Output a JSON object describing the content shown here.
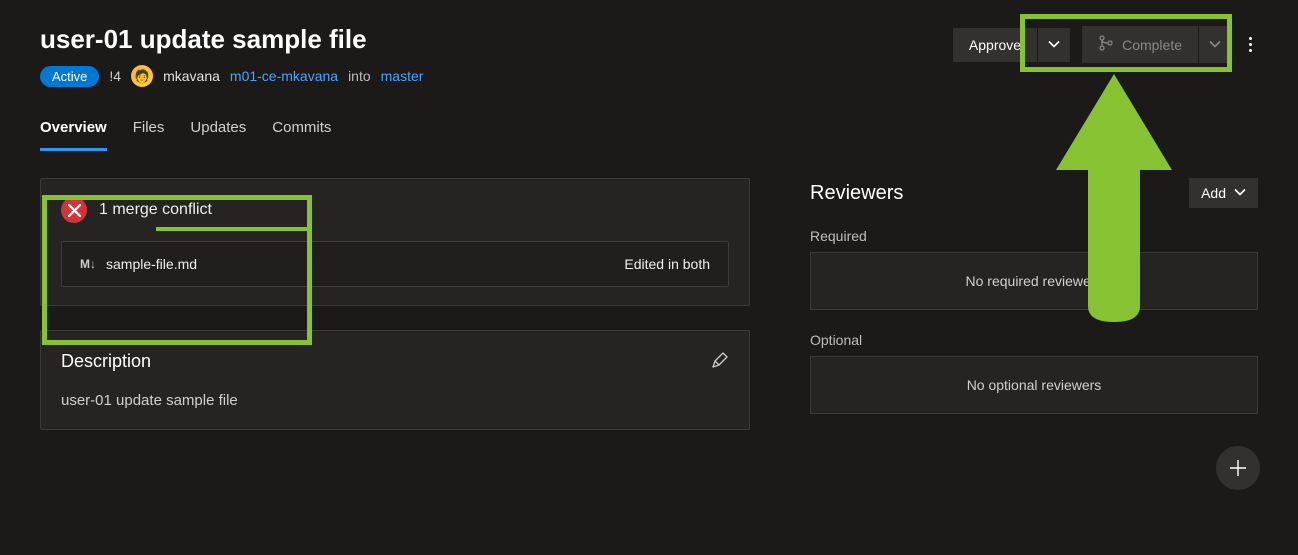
{
  "header": {
    "title": "user-01 update sample file",
    "status_badge": "Active",
    "conflict_indicator": "!4",
    "author": "mkavana",
    "source_branch": "m01-ce-mkavana",
    "into_word": "into",
    "target_branch": "master"
  },
  "actions": {
    "approve_label": "Approve",
    "complete_label": "Complete"
  },
  "tabs": [
    "Overview",
    "Files",
    "Updates",
    "Commits"
  ],
  "active_tab": "Overview",
  "conflict": {
    "title": "1 merge conflict",
    "file_name": "sample-file.md",
    "file_status": "Edited in both"
  },
  "description": {
    "heading": "Description",
    "body": "user-01 update sample file"
  },
  "reviewers": {
    "heading": "Reviewers",
    "add_label": "Add",
    "required_label": "Required",
    "required_empty": "No required reviewers",
    "optional_label": "Optional",
    "optional_empty": "No optional reviewers"
  }
}
